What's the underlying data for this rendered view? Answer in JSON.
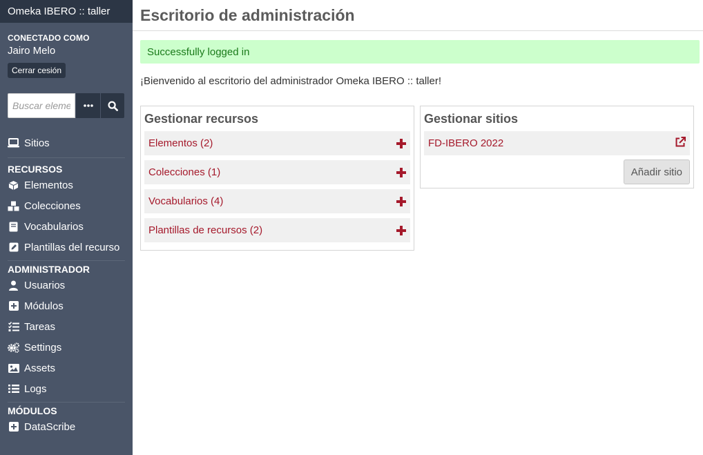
{
  "sidebar": {
    "site_title": "Omeka IBERO :: taller",
    "user_label": "CONECTADO COMO",
    "user_name": "Jairo Melo",
    "logout_label": "Cerrar cesión",
    "search_placeholder": "Buscar elementos",
    "sites_label": "Sitios",
    "sections": [
      {
        "label": "RECURSOS",
        "items": [
          {
            "label": "Elementos",
            "icon": "cube-icon"
          },
          {
            "label": "Colecciones",
            "icon": "cubes-icon"
          },
          {
            "label": "Vocabularios",
            "icon": "book-icon"
          },
          {
            "label": "Plantillas del recurso",
            "icon": "edit-icon"
          }
        ]
      },
      {
        "label": "ADMINISTRADOR",
        "items": [
          {
            "label": "Usuarios",
            "icon": "user-icon"
          },
          {
            "label": "Módulos",
            "icon": "plus-square-icon"
          },
          {
            "label": "Tareas",
            "icon": "tasks-icon"
          },
          {
            "label": "Settings",
            "icon": "cogs-icon"
          },
          {
            "label": "Assets",
            "icon": "image-icon"
          },
          {
            "label": "Logs",
            "icon": "list-icon"
          }
        ]
      },
      {
        "label": "MÓDULOS",
        "items": [
          {
            "label": "DataScribe",
            "icon": "plus-square-icon"
          }
        ]
      }
    ]
  },
  "main": {
    "title": "Escritorio de administración",
    "alert": "Successfully logged in",
    "welcome": "¡Bienvenido al escritorio del administrador Omeka IBERO :: taller!",
    "resources_panel": {
      "title": "Gestionar recursos",
      "rows": [
        "Elementos (2)",
        "Colecciones (1)",
        "Vocabularios (4)",
        "Plantillas de recursos (2)"
      ]
    },
    "sites_panel": {
      "title": "Gestionar sitios",
      "sites": [
        "FD-IBERO 2022"
      ],
      "add_label": "Añadir sitio"
    }
  },
  "colors": {
    "sidebar": "#4a5568",
    "sidebar_dark": "#2c3645",
    "accent": "#a5192b",
    "alert_bg": "#ccffcc",
    "alert_text": "#1a7a1a"
  }
}
